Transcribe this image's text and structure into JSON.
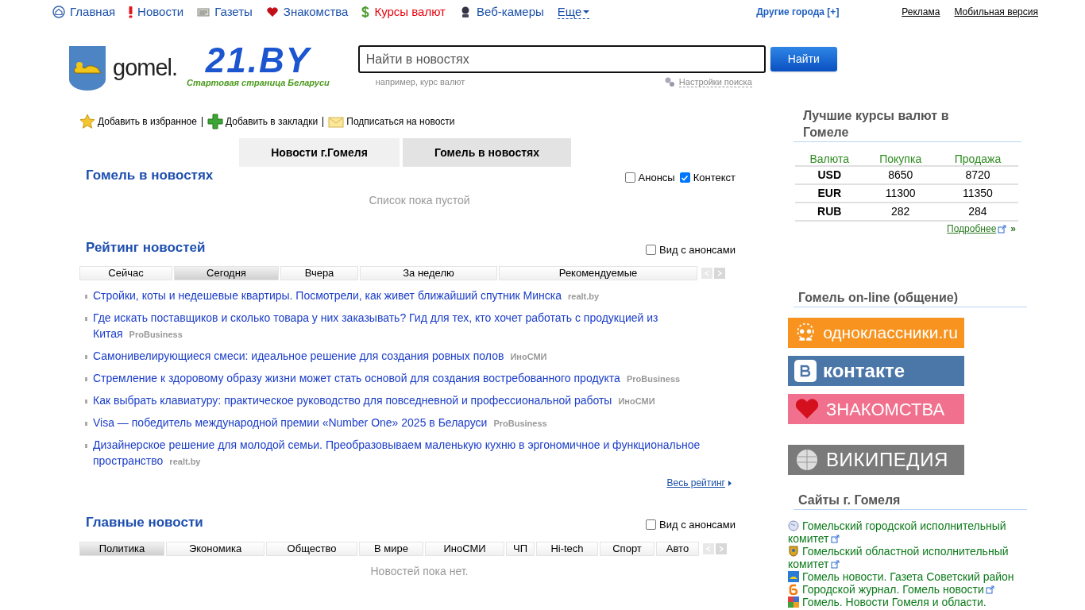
{
  "top_nav": {
    "items": [
      {
        "label": "Главная",
        "highlight": false
      },
      {
        "label": "Новости",
        "highlight": false
      },
      {
        "label": "Газеты",
        "highlight": false
      },
      {
        "label": "Знакомства",
        "highlight": false
      },
      {
        "label": "Курсы валют",
        "highlight": true
      },
      {
        "label": "Веб-камеры",
        "highlight": false
      }
    ],
    "more": "Еще",
    "other_cities": "Другие города [+]",
    "links": [
      "Реклама",
      "Мобильная версия"
    ]
  },
  "header": {
    "logo_city": "gomel.",
    "logo_brand": "21.BY",
    "tagline": "Стартовая страница Беларуси",
    "search": {
      "placeholder": "Найти в новостях",
      "hint": "например, курс валют",
      "button": "Найти",
      "settings": "Настройки поиска"
    }
  },
  "actions": [
    {
      "label": "Добавить в избранное"
    },
    {
      "label": "Добавить в закладки"
    },
    {
      "label": "Подписаться на новости"
    }
  ],
  "city_tabs": [
    {
      "label": "Новости г.Гомеля",
      "selected": false
    },
    {
      "label": "Гомель в новостях",
      "selected": true
    }
  ],
  "city_news": {
    "title": "Гомель в новостях",
    "options": [
      {
        "label": "Анонсы",
        "checked": false
      },
      {
        "label": "Контекст",
        "checked": true
      }
    ],
    "empty": "Список пока пустой"
  },
  "rating": {
    "title": "Рейтинг новостей",
    "option": {
      "label": "Вид с анонсами",
      "checked": false
    },
    "tabs": [
      {
        "label": "Сейчас",
        "selected": false
      },
      {
        "label": "Сегодня",
        "selected": true
      },
      {
        "label": "Вчера",
        "selected": false
      },
      {
        "label": "За неделю",
        "selected": false
      },
      {
        "label": "Рекомендуемые",
        "selected": false
      }
    ],
    "items": [
      {
        "title": "Стройки, коты и недешевые квартиры. Посмотрели, как живет ближайший спутник Минска",
        "source": "realt.by"
      },
      {
        "title": "Где искать поставщиков и сколько товара у них заказывать? Гид для тех, кто хочет работать с продукцией из Китая",
        "source": "ProBusiness"
      },
      {
        "title": "Самонивелирующиеся смеси: идеальное решение для создания ровных полов",
        "source": "ИноСМИ"
      },
      {
        "title": "Стремление к здоровому образу жизни может стать основой для создания востребованного продукта",
        "source": "ProBusiness"
      },
      {
        "title": "Как выбрать клавиатуру: практическое руководство для повседневной и профессиональной работы",
        "source": "ИноСМИ"
      },
      {
        "title": "Visa — победитель международной премии «Number One» 2025 в Беларуси",
        "source": "ProBusiness"
      },
      {
        "title": "Дизайнерское решение для молодой семьи. Преобразовываем маленькую кухню в эргономичное и функциональное пространство",
        "source": "realt.by"
      }
    ],
    "more": "Весь рейтинг"
  },
  "main_news": {
    "title": "Главные новости",
    "option": {
      "label": "Вид с анонсами",
      "checked": false
    },
    "tabs": [
      {
        "label": "Политика",
        "selected": true
      },
      {
        "label": "Экономика",
        "selected": false
      },
      {
        "label": "Общество",
        "selected": false
      },
      {
        "label": "В мире",
        "selected": false
      },
      {
        "label": "ИноСМИ",
        "selected": false
      },
      {
        "label": "ЧП",
        "selected": false
      },
      {
        "label": "Hi-tech",
        "selected": false
      },
      {
        "label": "Спорт",
        "selected": false
      },
      {
        "label": "Авто",
        "selected": false
      }
    ],
    "empty": "Новостей пока нет."
  },
  "rates": {
    "title": "Лучшие курсы валют в Гомеле",
    "columns": [
      "Валюта",
      "Покупка",
      "Продажа"
    ],
    "rows": [
      {
        "currency": "USD",
        "buy": "8650",
        "sell": "8720"
      },
      {
        "currency": "EUR",
        "buy": "11300",
        "sell": "11350"
      },
      {
        "currency": "RUB",
        "buy": "282",
        "sell": "284"
      }
    ],
    "more": "Подробнее",
    "more_arrow": "»"
  },
  "online": {
    "title": "Гомель on-line (общение)",
    "banners": [
      {
        "kind": "ok",
        "label": "одноклассники.ru",
        "color": "#f7931e"
      },
      {
        "kind": "vk",
        "label": "контакте",
        "color": "#4a76a8"
      },
      {
        "kind": "dating",
        "label": "ЗНАКОМСТВА",
        "color": "#f0708d"
      },
      {
        "kind": "wiki",
        "label": "ВИКИПЕДИЯ",
        "color": "#7a7a7a"
      }
    ]
  },
  "sites": {
    "title": "Сайты г. Гомеля",
    "items": [
      {
        "label": "Гомельский городской исполнительный комитет",
        "external": true
      },
      {
        "label": "Гомельский областной исполнительный комитет",
        "external": true
      },
      {
        "label": "Гомель новости. Газета Советский район",
        "external": false
      },
      {
        "label": "Городской журнал. Гомель новости",
        "external": true
      },
      {
        "label": "Гомель. Новости Гомеля и области.",
        "external": false
      }
    ]
  }
}
